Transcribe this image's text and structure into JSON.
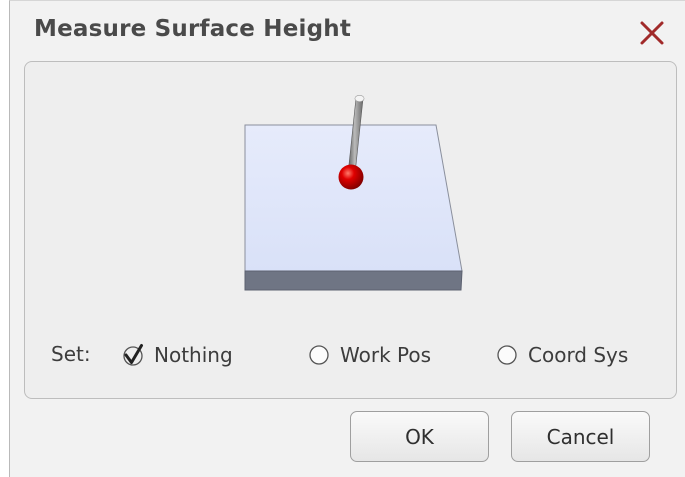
{
  "dialog": {
    "title": "Measure Surface Height",
    "close_icon": "close-x-icon"
  },
  "illustration": {
    "icon": "probe-on-surface-illustration",
    "colors": {
      "surface_top": "#dfe6fb",
      "surface_side": "#6f7584",
      "probe_tip": "#d40000",
      "probe_shaft": "#8a8a8a"
    }
  },
  "set_options": {
    "label": "Set:",
    "selected": "Nothing",
    "options": [
      {
        "label": "Nothing",
        "checked": true
      },
      {
        "label": "Work Pos",
        "checked": false
      },
      {
        "label": "Coord Sys",
        "checked": false
      }
    ]
  },
  "buttons": {
    "ok_label": "OK",
    "cancel_label": "Cancel"
  },
  "colors": {
    "close_x": "#a12a2a",
    "title_text": "#4a4a4a",
    "dialog_bg": "#f2f2f2"
  }
}
